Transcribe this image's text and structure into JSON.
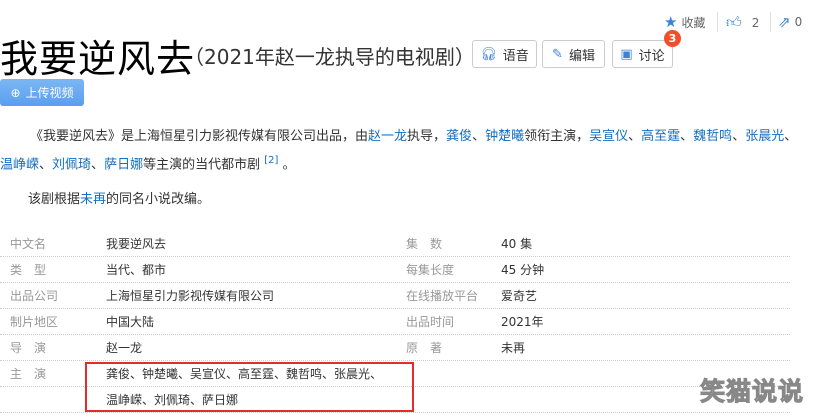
{
  "header": {
    "title": "我要逆风去",
    "subtitle": "（2021年赵一龙执导的电视剧）"
  },
  "actions": {
    "collect": "收藏",
    "like_count": "2",
    "share_count": "0",
    "voice": "语音",
    "edit": "编辑",
    "discuss": "讨论",
    "discuss_badge": "3",
    "upload_video": "上传视频"
  },
  "summary": {
    "p1": [
      {
        "t": "《我要逆风去》是上海恒星引力影视传媒有限公司出品，由",
        "link": false
      },
      {
        "t": "赵一龙",
        "link": true
      },
      {
        "t": "执导，",
        "link": false
      },
      {
        "t": "龚俊",
        "link": true
      },
      {
        "t": "、",
        "link": false
      },
      {
        "t": "钟楚曦",
        "link": true
      },
      {
        "t": "领衔主演，",
        "link": false
      },
      {
        "t": "吴宣仪",
        "link": true
      },
      {
        "t": "、",
        "link": false
      },
      {
        "t": "高至霆",
        "link": true
      },
      {
        "t": "、",
        "link": false
      },
      {
        "t": "魏哲鸣",
        "link": true
      },
      {
        "t": "、",
        "link": false
      },
      {
        "t": "张晨光",
        "link": true
      },
      {
        "t": "、",
        "link": false
      },
      {
        "t": "温峥嵘",
        "link": true
      },
      {
        "t": "、",
        "link": false
      },
      {
        "t": "刘佩琦",
        "link": true
      },
      {
        "t": "、",
        "link": false
      },
      {
        "t": "萨日娜",
        "link": true
      },
      {
        "t": "等主演的当代都市剧 ",
        "link": false
      }
    ],
    "ref": "[2]",
    "p1_end": " 。",
    "p2_pre": "该剧根据",
    "p2_link": "未再",
    "p2_post": "的同名小说改编。"
  },
  "infobox": {
    "rows": [
      {
        "l1": "中文名",
        "v1": "我要逆风去",
        "l2": "集　数",
        "v2": "40 集"
      },
      {
        "l1": "类　型",
        "v1": "当代、都市",
        "l2": "每集长度",
        "v2": "45 分钟"
      },
      {
        "l1": "出品公司",
        "v1": "上海恒星引力影视传媒有限公司",
        "l2": "在线播放平台",
        "v2": "爱奇艺"
      },
      {
        "l1": "制片地区",
        "v1": "中国大陆",
        "l2": "出品时间",
        "v2": "2021年"
      },
      {
        "l1": "导　演",
        "v1": "赵一龙",
        "l2": "原　著",
        "v2": "未再"
      }
    ],
    "cast_label": "主　演",
    "cast_line1": "龚俊、钟楚曦、吴宣仪、高至霆、魏哲鸣、张晨光、",
    "cast_line2": "温峥嵘、刘佩琦、萨日娜"
  },
  "watermark": "笑猫说说"
}
